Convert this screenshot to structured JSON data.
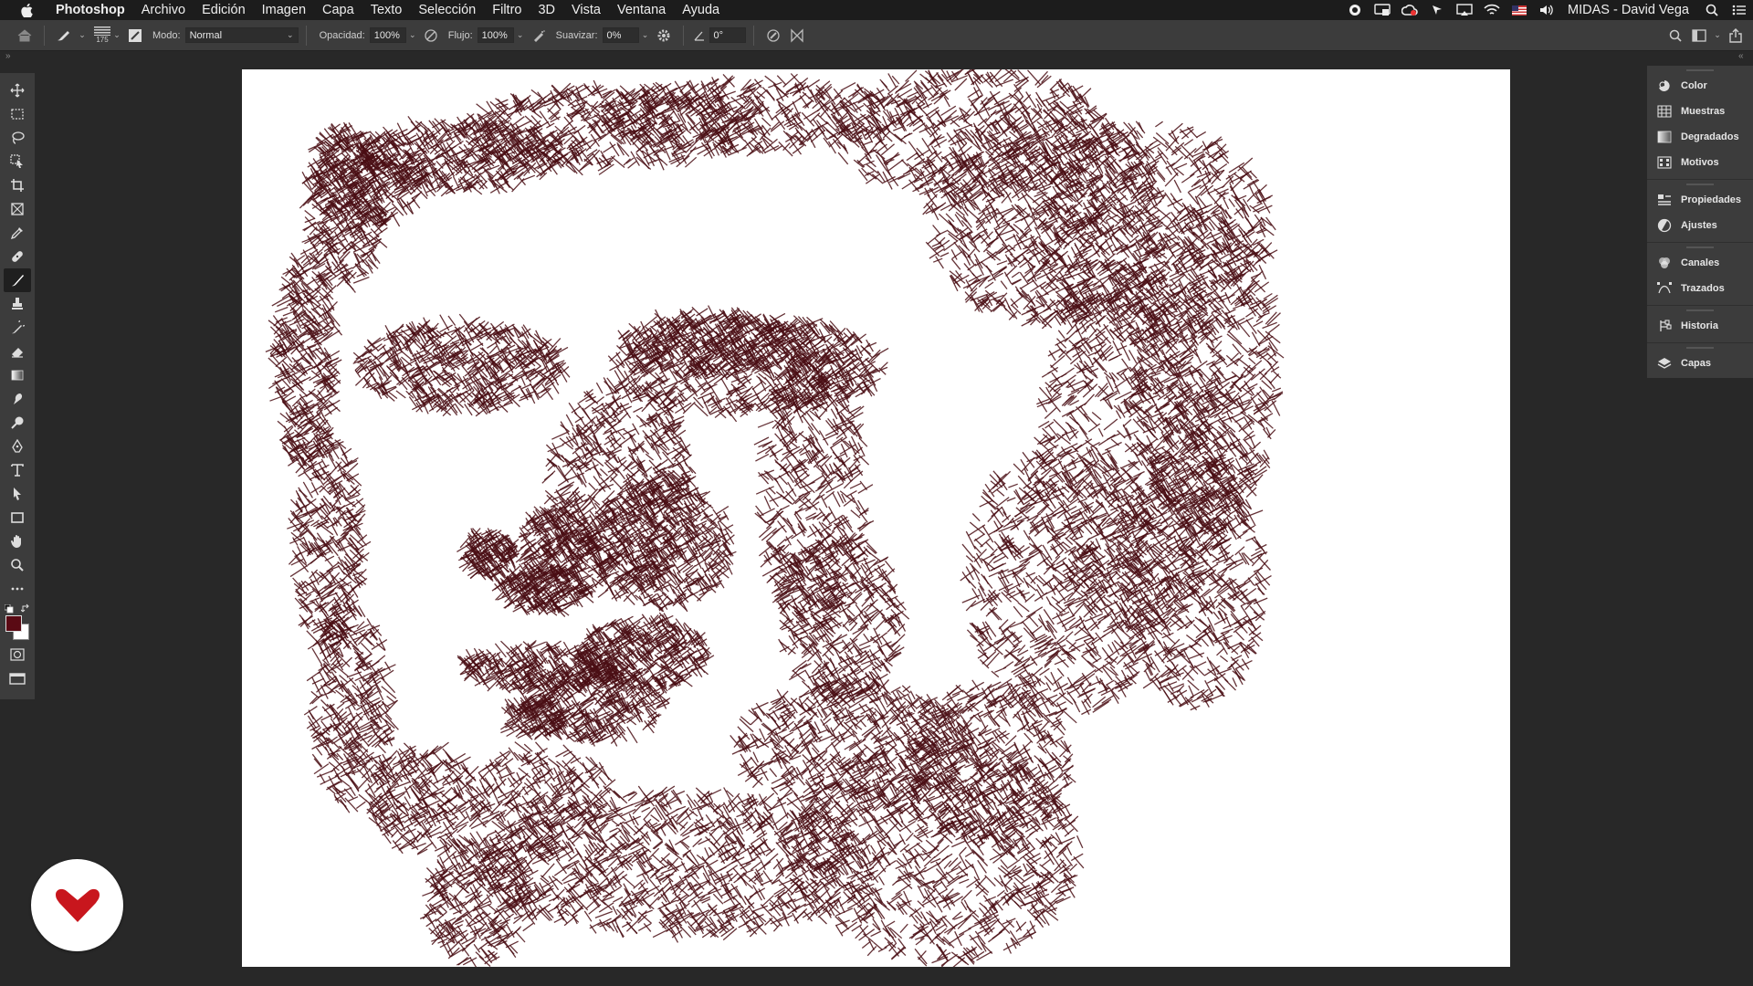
{
  "menubar": {
    "app_name": "Photoshop",
    "menus": [
      "Archivo",
      "Edición",
      "Imagen",
      "Capa",
      "Texto",
      "Selección",
      "Filtro",
      "3D",
      "Vista",
      "Ventana",
      "Ayuda"
    ],
    "status_icons": [
      "record-icon",
      "display-icon",
      "creative-cloud-icon",
      "cursor-icon",
      "airplay-icon",
      "wifi-icon",
      "flag-us-icon",
      "volume-icon"
    ],
    "user": "MIDAS - David Vega"
  },
  "options": {
    "brush_size": "175",
    "mode_label": "Modo:",
    "mode_value": "Normal",
    "opacity_label": "Opacidad:",
    "opacity_value": "100%",
    "flow_label": "Flujo:",
    "flow_value": "100%",
    "smoothing_label": "Suavizar:",
    "smoothing_value": "0%",
    "angle_value": "0°"
  },
  "tools": [
    "move-tool-icon",
    "marquee-tool-icon",
    "lasso-tool-icon",
    "object-select-tool-icon",
    "crop-tool-icon",
    "frame-tool-icon",
    "eyedropper-tool-icon",
    "healing-brush-tool-icon",
    "brush-tool-icon",
    "clone-stamp-tool-icon",
    "history-brush-tool-icon",
    "eraser-tool-icon",
    "gradient-tool-icon",
    "smudge-tool-icon",
    "dodge-tool-icon",
    "pen-tool-icon",
    "type-tool-icon",
    "path-select-tool-icon",
    "rectangle-tool-icon",
    "hand-tool-icon",
    "zoom-tool-icon",
    "more-tools-icon"
  ],
  "active_tool": "brush-tool-icon",
  "colors": {
    "foreground": "#5a0a14",
    "background": "#ffffff",
    "stroke": "#4a0e14",
    "ui_dark": "#282828",
    "ui_panel": "#3c3c3c",
    "logo_red": "#c8161d"
  },
  "dock": {
    "groups": [
      [
        {
          "label": "Color",
          "icon": "color-wheel-icon"
        },
        {
          "label": "Muestras",
          "icon": "swatches-grid-icon"
        },
        {
          "label": "Degradados",
          "icon": "gradient-square-icon"
        },
        {
          "label": "Motivos",
          "icon": "pattern-grid-icon"
        }
      ],
      [
        {
          "label": "Propiedades",
          "icon": "properties-sliders-icon"
        },
        {
          "label": "Ajustes",
          "icon": "adjustments-circle-icon"
        }
      ],
      [
        {
          "label": "Canales",
          "icon": "channels-icon"
        },
        {
          "label": "Trazados",
          "icon": "paths-icon"
        }
      ],
      [
        {
          "label": "Historia",
          "icon": "history-icon"
        }
      ],
      [
        {
          "label": "Capas",
          "icon": "layers-icon"
        }
      ]
    ]
  }
}
